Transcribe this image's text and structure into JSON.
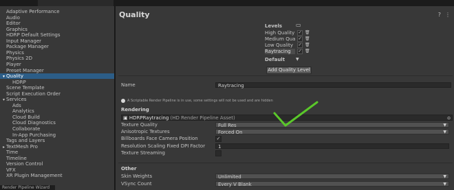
{
  "sidebar": {
    "items": [
      {
        "label": "Adaptive Performance",
        "indent": 0
      },
      {
        "label": "Audio",
        "indent": 0
      },
      {
        "label": "Editor",
        "indent": 0
      },
      {
        "label": "Graphics",
        "indent": 0
      },
      {
        "label": "HDRP Default Settings",
        "indent": 0
      },
      {
        "label": "Input Manager",
        "indent": 0
      },
      {
        "label": "Package Manager",
        "indent": 0
      },
      {
        "label": "Physics",
        "indent": 0
      },
      {
        "label": "Physics 2D",
        "indent": 0
      },
      {
        "label": "Player",
        "indent": 0
      },
      {
        "label": "Preset Manager",
        "indent": 0
      },
      {
        "label": "Quality",
        "indent": 0,
        "expanded": true,
        "selected": true
      },
      {
        "label": "HDRP",
        "indent": 2
      },
      {
        "label": "Scene Template",
        "indent": 0
      },
      {
        "label": "Script Execution Order",
        "indent": 0
      },
      {
        "label": "Services",
        "indent": 0,
        "expanded": true
      },
      {
        "label": "Ads",
        "indent": 2
      },
      {
        "label": "Analytics",
        "indent": 2
      },
      {
        "label": "Cloud Build",
        "indent": 2
      },
      {
        "label": "Cloud Diagnostics",
        "indent": 2
      },
      {
        "label": "Collaborate",
        "indent": 2
      },
      {
        "label": "In-App Purchasing",
        "indent": 2
      },
      {
        "label": "Tags and Layers",
        "indent": 0
      },
      {
        "label": "TextMesh Pro",
        "indent": 0,
        "collapsed": true
      },
      {
        "label": "Time",
        "indent": 0
      },
      {
        "label": "Timeline",
        "indent": 0
      },
      {
        "label": "Version Control",
        "indent": 0
      },
      {
        "label": "VFX",
        "indent": 0
      },
      {
        "label": "XR Plugin Management",
        "indent": 0
      }
    ],
    "bottom_tab": "Render Pipeline Wizard"
  },
  "header": {
    "title": "Quality",
    "icons": [
      "help-icon",
      "settings-icon"
    ]
  },
  "levels": {
    "title": "Levels",
    "items": [
      {
        "name": "High Quality",
        "checked": true
      },
      {
        "name": "Medium Quali",
        "checked": true
      },
      {
        "name": "Low Quality",
        "checked": true
      },
      {
        "name": "Raytracing",
        "checked": true,
        "selected": true
      }
    ],
    "default_label": "Default",
    "add_button": "Add Quality Level"
  },
  "name_row": {
    "label": "Name",
    "value": "Raytracing"
  },
  "info_text": "A Scriptable Render Pipeline is in use, some settings will not be used and are hidden",
  "rendering": {
    "section": "Rendering",
    "pipeline_asset": "HDRPRaytracing",
    "pipeline_asset_type": "(HD Render Pipeline Asset)",
    "rows": [
      {
        "label": "Texture Quality",
        "value": "Full Res",
        "kind": "dropdown"
      },
      {
        "label": "Anisotropic Textures",
        "value": "Forced On",
        "kind": "dropdown"
      },
      {
        "label": "Billboards Face Camera Position",
        "value": "✓",
        "kind": "check"
      },
      {
        "label": "Resolution Scaling Fixed DPI Factor",
        "value": "1",
        "kind": "field"
      },
      {
        "label": "Texture Streaming",
        "value": "",
        "kind": "check"
      }
    ]
  },
  "other": {
    "section": "Other",
    "rows": [
      {
        "label": "Skin Weights",
        "value": "Unlimited",
        "kind": "dropdown"
      },
      {
        "label": "VSync Count",
        "value": "Every V Blank",
        "kind": "dropdown"
      }
    ]
  },
  "colors": {
    "selection": "#2c5d87",
    "panel": "#383838",
    "annotation": "#5ac82a"
  }
}
